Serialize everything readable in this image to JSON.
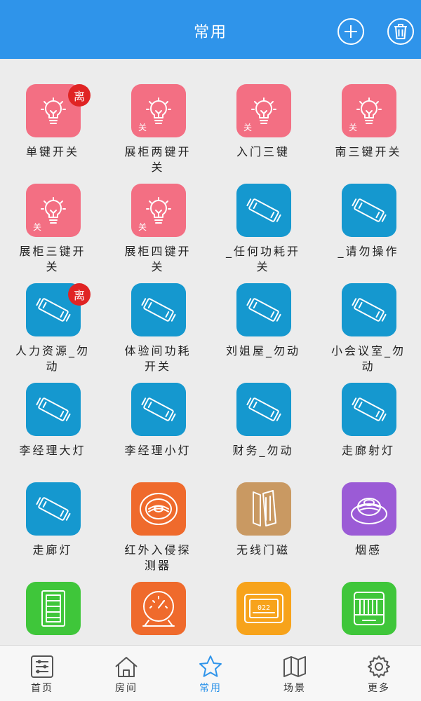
{
  "header": {
    "title": "常用",
    "add_icon": "add-icon",
    "delete_icon": "trash-icon"
  },
  "colors": {
    "header": "#2f94ea",
    "pink": "#f36f83",
    "blue": "#1598cf",
    "orange": "#ef6a2c",
    "tan": "#c99962",
    "purple": "#9b5bd6",
    "green": "#3fc63a",
    "amber": "#f7a31b",
    "badge": "#e02424",
    "tab_active": "#2f94ea"
  },
  "devices": [
    {
      "label": "单键开关",
      "icon": "bulb-icon",
      "color": "pink",
      "badge": "离"
    },
    {
      "label": "展柜两键开关",
      "icon": "bulb-icon",
      "color": "pink",
      "status": "关"
    },
    {
      "label": "入门三键",
      "icon": "bulb-icon",
      "color": "pink",
      "status": "关"
    },
    {
      "label": "南三键开关",
      "icon": "bulb-icon",
      "color": "pink",
      "status": "关"
    },
    {
      "label": "展柜三键开关",
      "icon": "bulb-icon",
      "color": "pink",
      "status": "关"
    },
    {
      "label": "展柜四键开关",
      "icon": "bulb-icon",
      "color": "pink",
      "status": "关"
    },
    {
      "label": "_任何功耗开关",
      "icon": "tube-light-icon",
      "color": "blue"
    },
    {
      "label": "_请勿操作",
      "icon": "tube-light-icon",
      "color": "blue"
    },
    {
      "label": "人力资源_勿动",
      "icon": "tube-light-icon",
      "color": "blue",
      "badge": "离"
    },
    {
      "label": "体验间功耗开关",
      "icon": "tube-light-icon",
      "color": "blue"
    },
    {
      "label": "刘姐屋_勿动",
      "icon": "tube-light-icon",
      "color": "blue"
    },
    {
      "label": "小会议室_勿动",
      "icon": "tube-light-icon",
      "color": "blue"
    },
    {
      "label": "李经理大灯",
      "icon": "tube-light-icon",
      "color": "blue"
    },
    {
      "label": "李经理小灯",
      "icon": "tube-light-icon",
      "color": "blue"
    },
    {
      "label": "财务_勿动",
      "icon": "tube-light-icon",
      "color": "blue"
    },
    {
      "label": "走廊射灯",
      "icon": "tube-light-icon",
      "color": "blue"
    },
    {
      "label": "走廊灯",
      "icon": "tube-light-icon",
      "color": "blue"
    },
    {
      "label": "红外入侵探测器",
      "icon": "infrared-detector-icon",
      "color": "orange"
    },
    {
      "label": "无线门磁",
      "icon": "door-sensor-icon",
      "color": "tan"
    },
    {
      "label": "烟感",
      "icon": "smoke-detector-icon",
      "color": "purple"
    },
    {
      "label": "",
      "icon": "device-panel-icon",
      "color": "green"
    },
    {
      "label": "",
      "icon": "gauge-icon",
      "color": "orange"
    },
    {
      "label": "",
      "icon": "thermostat-icon",
      "color": "amber",
      "screen_text": "022"
    },
    {
      "label": "",
      "icon": "heater-icon",
      "color": "green"
    }
  ],
  "tabs": [
    {
      "label": "首页",
      "icon": "sliders-icon"
    },
    {
      "label": "房间",
      "icon": "house-icon"
    },
    {
      "label": "常用",
      "icon": "star-icon",
      "active": true
    },
    {
      "label": "场景",
      "icon": "map-icon"
    },
    {
      "label": "更多",
      "icon": "gear-icon"
    }
  ]
}
